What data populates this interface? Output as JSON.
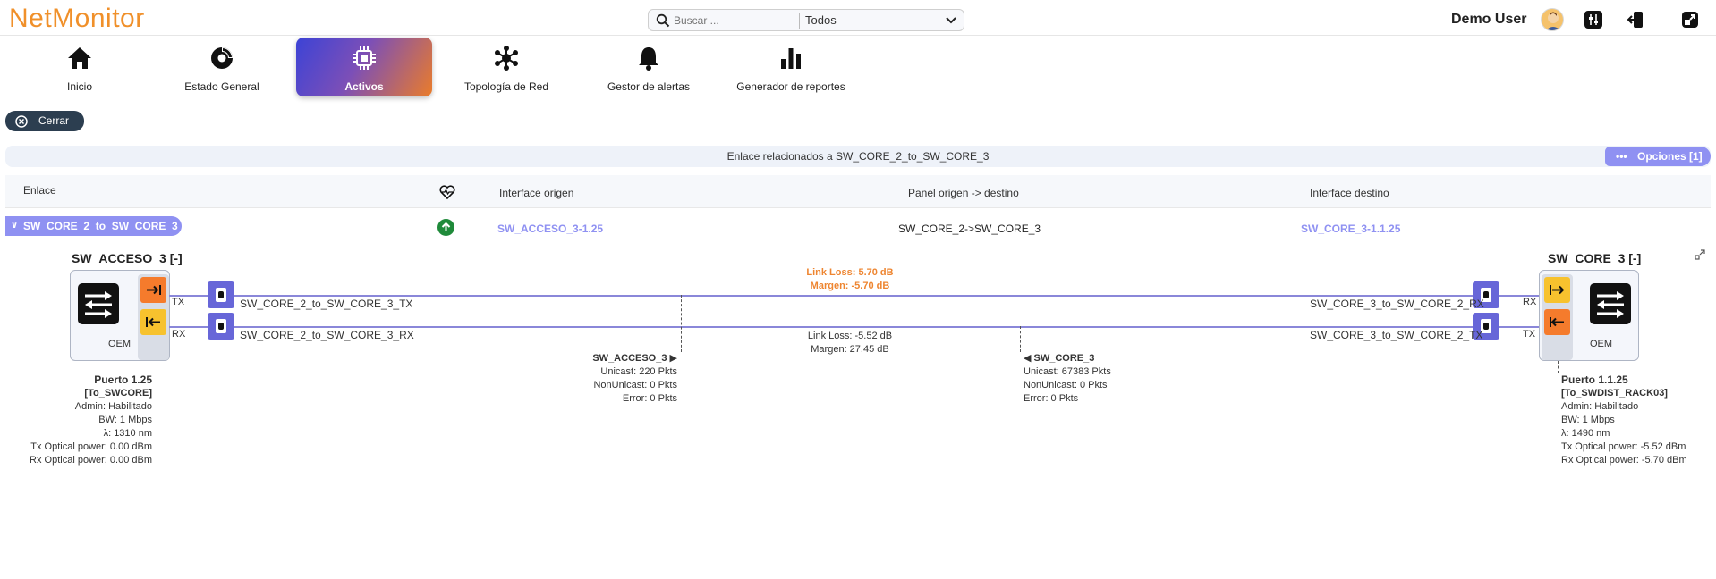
{
  "app": {
    "title": "NetMonitor"
  },
  "search": {
    "placeholder": "Buscar ...",
    "scope": "Todos"
  },
  "user": {
    "name": "Demo User"
  },
  "nav": [
    {
      "label": "Inicio",
      "icon": "home-icon"
    },
    {
      "label": "Estado General",
      "icon": "dashboard-icon"
    },
    {
      "label": "Activos",
      "icon": "chip-icon",
      "active": true
    },
    {
      "label": "Topología de Red",
      "icon": "topology-icon"
    },
    {
      "label": "Gestor de alertas",
      "icon": "bell-icon"
    },
    {
      "label": "Generador de reportes",
      "icon": "bar-chart-icon"
    }
  ],
  "close_label": "Cerrar",
  "panel": {
    "title": "Enlace relacionados a SW_CORE_2_to_SW_CORE_3",
    "options_label": "Opciones [1]"
  },
  "table": {
    "headers": {
      "link": "Enlace",
      "origin_interface": "Interface origen",
      "panel": "Panel origen -> destino",
      "dest_interface": "Interface destino"
    },
    "row": {
      "link": "SW_CORE_2_to_SW_CORE_3",
      "status": "up",
      "origin_interface": "SW_ACCESO_3-1.25",
      "panel": "SW_CORE_2->SW_CORE_3",
      "dest_interface": "SW_CORE_3-1.1.25"
    }
  },
  "diagram": {
    "left_device": {
      "title": "SW_ACCESO_3 [-]",
      "vendor": "OEM",
      "tx_label": "TX",
      "rx_label": "RX",
      "port": {
        "name": "Puerto 1.25",
        "description": "[To_SWCORE]",
        "admin": "Admin: Habilitado",
        "bw": "BW: 1 Mbps",
        "lambda": "λ: 1310 nm",
        "tx_power": "Tx Optical power: 0.00 dBm",
        "rx_power": "Rx Optical power: 0.00 dBm"
      },
      "stats": {
        "title": "SW_ACCESO_3 ▶",
        "unicast": "Unicast: 220 Pkts",
        "nonunicast": "NonUnicast: 0 Pkts",
        "error": "Error: 0 Pkts"
      }
    },
    "right_device": {
      "title": "SW_CORE_3 [-]",
      "vendor": "OEM",
      "tx_label": "TX",
      "rx_label": "RX",
      "port": {
        "name": "Puerto 1.1.25",
        "description": "[To_SWDIST_RACK03]",
        "admin": "Admin: Habilitado",
        "bw": "BW: 1 Mbps",
        "lambda": "λ: 1490 nm",
        "tx_power": "Tx Optical power: -5.52 dBm",
        "rx_power": "Rx Optical power: -5.70 dBm"
      },
      "stats": {
        "title": "◀ SW_CORE_3",
        "unicast": "Unicast: 67383 Pkts",
        "nonunicast": "NonUnicast: 0 Pkts",
        "error": "Error: 0 Pkts"
      }
    },
    "fibers": {
      "top_left": "SW_CORE_2_to_SW_CORE_3_TX",
      "top_right": "SW_CORE_3_to_SW_CORE_2_RX",
      "bottom_left": "SW_CORE_2_to_SW_CORE_3_RX",
      "bottom_right": "SW_CORE_3_to_SW_CORE_2_TX"
    },
    "loss_top": {
      "link_loss": "Link Loss: 5.70 dB",
      "margin": "Margen: -5.70 dB"
    },
    "loss_bottom": {
      "link_loss": "Link Loss: -5.52 dB",
      "margin": "Margen: 27.45 dB"
    }
  }
}
